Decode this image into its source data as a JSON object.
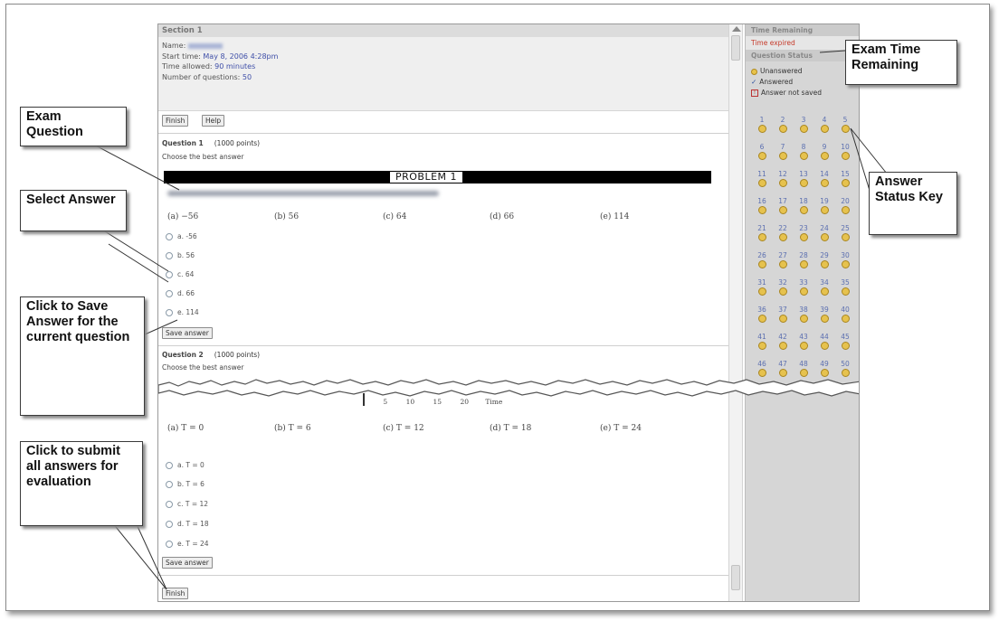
{
  "section": {
    "title": "Section 1",
    "name_label": "Name:",
    "start_label": "Start time:",
    "start_value": "May 8, 2006 4:28pm",
    "allowed_label": "Time allowed:",
    "allowed_value": "90 minutes",
    "questions_label": "Number of questions:",
    "questions_value": "50"
  },
  "toolbar": {
    "finish": "Finish",
    "help": "Help"
  },
  "question1": {
    "title": "Question 1",
    "points": "(1000 points)",
    "instruction": "Choose the best answer",
    "problem_label": "PROBLEM 1",
    "math_choices": [
      "(a) −56",
      "(b) 56",
      "(c) 64",
      "(d) 66",
      "(e) 114"
    ],
    "options": [
      "a. -56",
      "b. 56",
      "c. 64",
      "d. 66",
      "e. 114"
    ],
    "save_label": "Save answer"
  },
  "question2": {
    "title": "Question 2",
    "points": "(1000 points)",
    "instruction": "Choose the best answer",
    "timeline_ticks": [
      "5",
      "10",
      "15",
      "20"
    ],
    "timeline_label": "Time",
    "math_choices": [
      "(a) T = 0",
      "(b) T = 6",
      "(c) T = 12",
      "(d) T = 18",
      "(e) T = 24"
    ],
    "options": [
      "a. T = 0",
      "b. T = 6",
      "c. T = 12",
      "d. T = 18",
      "e. T = 24"
    ],
    "save_label": "Save answer"
  },
  "bottom_finish": "Finish",
  "sidebar": {
    "time_title": "Time Remaining",
    "time_value": "Time expired",
    "status_title": "Question Status",
    "legend": [
      "Unanswered",
      "Answered",
      "Answer not saved"
    ],
    "numbers": [
      "1",
      "2",
      "3",
      "4",
      "5",
      "6",
      "7",
      "8",
      "9",
      "10",
      "11",
      "12",
      "13",
      "14",
      "15",
      "16",
      "17",
      "18",
      "19",
      "20",
      "21",
      "22",
      "23",
      "24",
      "25",
      "26",
      "27",
      "28",
      "29",
      "30",
      "31",
      "32",
      "33",
      "34",
      "35",
      "36",
      "37",
      "38",
      "39",
      "40",
      "41",
      "42",
      "43",
      "44",
      "45",
      "46",
      "47",
      "48",
      "49",
      "50"
    ]
  },
  "callouts": {
    "exam_question": "Exam Question",
    "select_answer": "Select Answer",
    "save_answer": "Click to Save Answer for the current question",
    "submit_all": "Click to submit all answers for evaluation",
    "time_remaining": "Exam Time Remaining",
    "status_key": "Answer Status Key"
  },
  "colors": {
    "accent_link": "#3f4fa8",
    "expired": "#c63a2a",
    "unanswered_dot": "#e6c24e"
  }
}
